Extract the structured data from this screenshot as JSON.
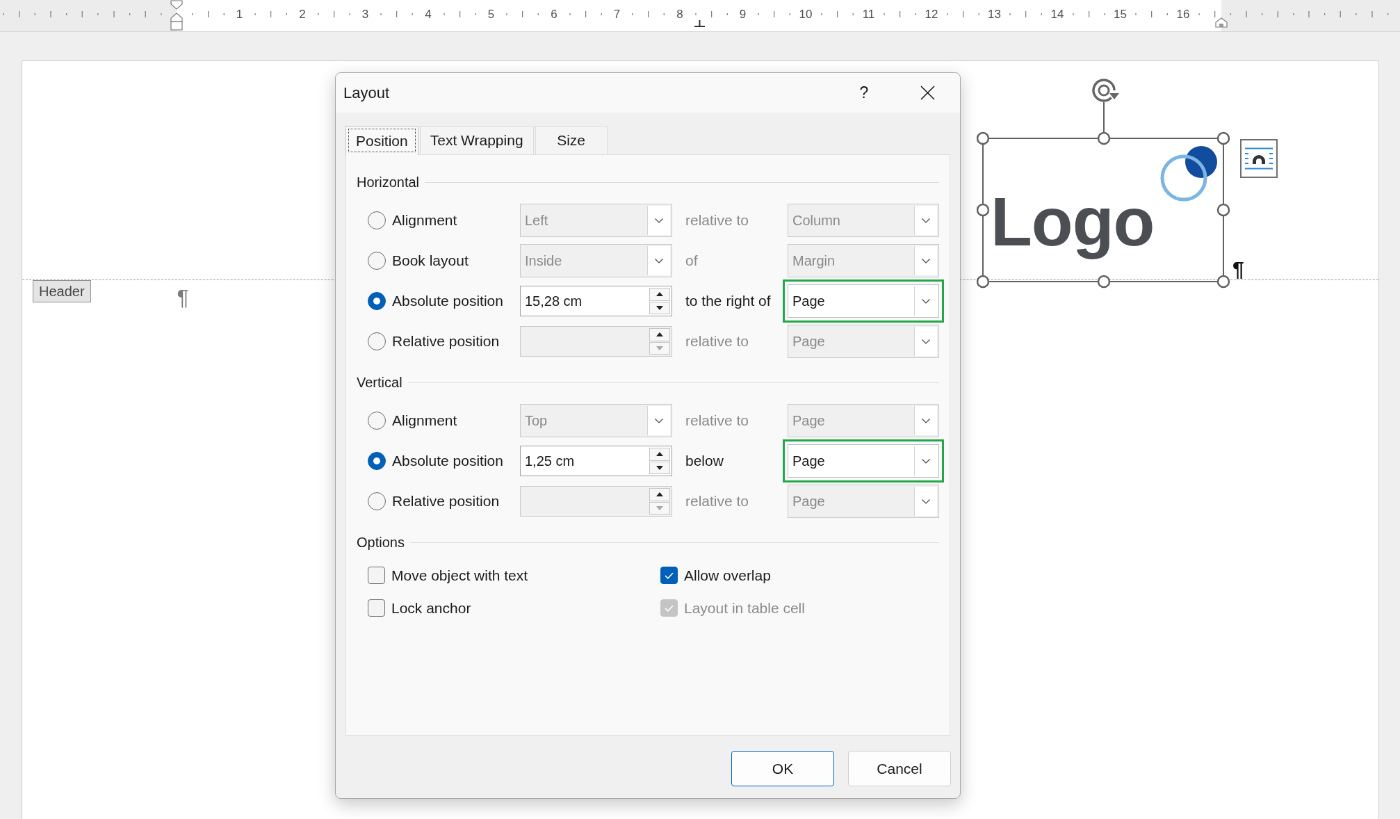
{
  "ruler": {
    "numbers": [
      "1",
      "2",
      "3",
      "4",
      "5",
      "6",
      "7",
      "8",
      "9",
      "10",
      "11",
      "12",
      "13",
      "14",
      "15",
      "16"
    ]
  },
  "document": {
    "header": {
      "tag": "Header",
      "paragraph_mark": "¶"
    },
    "logo_image": {
      "wordmark": "Logo",
      "selected": true,
      "paragraph_mark": "¶"
    }
  },
  "dialog": {
    "title": "Layout",
    "help_button": "?",
    "tabs": [
      {
        "label": "Position",
        "selected": true
      },
      {
        "label": "Text Wrapping",
        "selected": false
      },
      {
        "label": "Size",
        "selected": false
      }
    ],
    "sections": [
      {
        "title": "Horizontal",
        "rows": [
          {
            "label": "Alignment",
            "selected": false,
            "field": {
              "kind": "dropdown",
              "value": "Left",
              "disabled": true
            },
            "relation": {
              "text": "relative to",
              "disabled": true
            },
            "target": {
              "value": "Column",
              "disabled": true,
              "highlighted": false
            }
          },
          {
            "label": "Book layout",
            "selected": false,
            "field": {
              "kind": "dropdown",
              "value": "Inside",
              "disabled": true
            },
            "relation": {
              "text": "of",
              "disabled": true
            },
            "target": {
              "value": "Margin",
              "disabled": true,
              "highlighted": false
            }
          },
          {
            "label": "Absolute position",
            "selected": true,
            "field": {
              "kind": "spin",
              "value": "15,28 cm",
              "disabled": false
            },
            "relation": {
              "text": "to the right of",
              "disabled": false
            },
            "target": {
              "value": "Page",
              "disabled": false,
              "highlighted": true
            }
          },
          {
            "label": "Relative position",
            "selected": false,
            "field": {
              "kind": "spin",
              "disabled": true
            },
            "relation": {
              "text": "relative to",
              "disabled": true
            },
            "target": {
              "value": "Page",
              "disabled": true,
              "highlighted": false
            }
          }
        ]
      },
      {
        "title": "Vertical",
        "rows": [
          {
            "label": "Alignment",
            "selected": false,
            "field": {
              "kind": "dropdown",
              "value": "Top",
              "disabled": true
            },
            "relation": {
              "text": "relative to",
              "disabled": true
            },
            "target": {
              "value": "Page",
              "disabled": true,
              "highlighted": false
            }
          },
          {
            "label": "Absolute position",
            "selected": true,
            "field": {
              "kind": "spin",
              "value": "1,25 cm",
              "disabled": false
            },
            "relation": {
              "text": "below",
              "disabled": false
            },
            "target": {
              "value": "Page",
              "disabled": false,
              "highlighted": true
            }
          },
          {
            "label": "Relative position",
            "selected": false,
            "field": {
              "kind": "spin",
              "disabled": true
            },
            "relation": {
              "text": "relative to",
              "disabled": true
            },
            "target": {
              "value": "Page",
              "disabled": true,
              "highlighted": false
            }
          }
        ]
      }
    ],
    "options": {
      "title": "Options",
      "checkboxes": [
        {
          "label": "Move object with text",
          "checked": false,
          "disabled": false
        },
        {
          "label": "Allow overlap",
          "checked": true,
          "disabled": false
        },
        {
          "label": "Lock anchor",
          "checked": false,
          "disabled": false
        },
        {
          "label": "Layout in table cell",
          "checked": true,
          "disabled": true
        }
      ]
    },
    "buttons": [
      {
        "label": "OK",
        "default": true
      },
      {
        "label": "Cancel",
        "default": false
      }
    ]
  }
}
